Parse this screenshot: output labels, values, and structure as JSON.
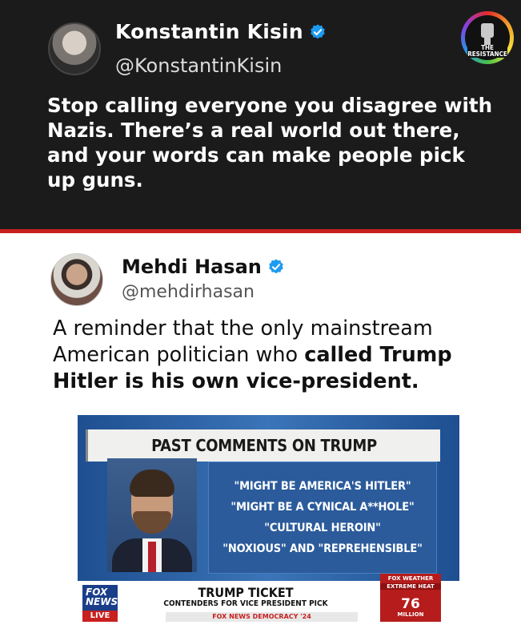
{
  "main_tweet": {
    "name": "Konstantin Kisin",
    "handle": "@KonstantinKisin",
    "text": "Stop calling everyone you disagree with Nazis. There’s a real world out there, and your words can make people pick up guns.",
    "verified_color": "#1d9bf0"
  },
  "badge": {
    "line1": "THE",
    "line2": "RESISTANCE"
  },
  "quoted_tweet": {
    "name": "Mehdi Hasan",
    "handle": "@mehdirhasan",
    "text_plain": "A reminder that the only mainstream American politician who ",
    "text_bold": "called Trump Hitler is his own vice-president."
  },
  "news_image": {
    "title": "PAST COMMENTS ON TRUMP",
    "quotes": [
      "\"MIGHT BE AMERICA'S HITLER\"",
      "\"MIGHT BE A CYNICAL A**HOLE\"",
      "\"CULTURAL HEROIN\"",
      "\"NOXIOUS\" AND \"REPREHENSIBLE\""
    ],
    "fox_logo": [
      "FOX",
      "NEWS",
      "LIVE"
    ],
    "ticket_title": "TRUMP TICKET",
    "ticket_sub": "CONTENDERS FOR VICE PRESIDENT PICK",
    "ticker": "FOX NEWS DEMOCRACY '24",
    "weather": {
      "brand": "FOX WEATHER",
      "label": "EXTREME HEAT",
      "value": "76",
      "unit": "MILLION"
    }
  }
}
